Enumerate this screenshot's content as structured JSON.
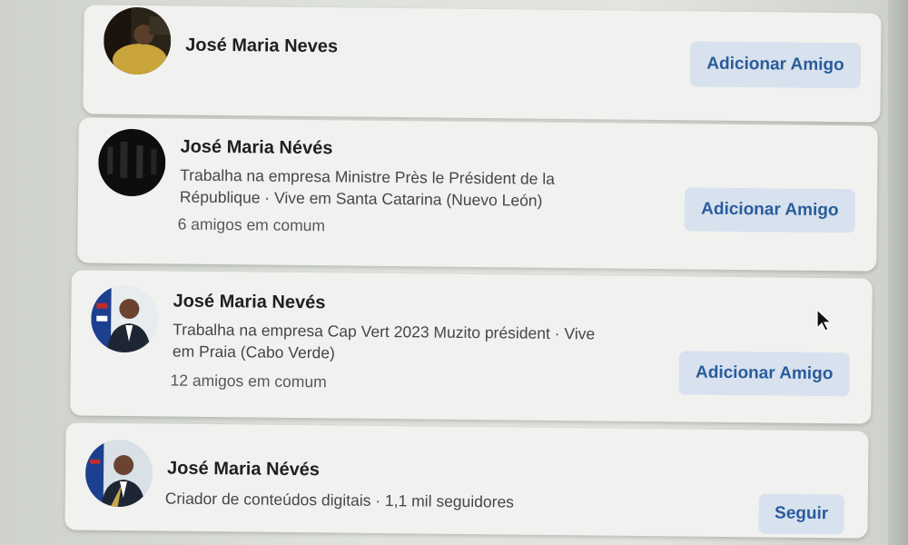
{
  "results": [
    {
      "name": "José Maria Neves",
      "description": "",
      "mutual": "",
      "action": "Adicionar Amigo",
      "avatar": "portrait-photo"
    },
    {
      "name": "José Maria Névés",
      "description_lines": [
        "Trabalha na empresa Ministre Près le Président de la",
        "République · Vive em Santa Catarina (Nuevo León)"
      ],
      "mutual": "6 amigos em comum",
      "action": "Adicionar Amigo",
      "avatar": "dark-photo"
    },
    {
      "name": "José Maria Nevés",
      "description_lines": [
        "Trabalha na empresa Cap Vert 2023 Muzito président · Vive",
        "em Praia (Cabo Verde)"
      ],
      "mutual": "12 amigos em comum",
      "action": "Adicionar Amigo",
      "avatar": "portrait-with-flag"
    },
    {
      "name": "José Maria Névés",
      "description_lines": [
        "Criador de conteúdos digitais · 1,1 mil seguidores"
      ],
      "mutual": "",
      "action": "Seguir",
      "avatar": "portrait-with-flag"
    }
  ],
  "colors": {
    "card_bg": "#f1f2ef",
    "button_bg": "#d7e2ee",
    "button_text": "#2a5c9c",
    "name_text": "#1f1f1f"
  },
  "icons": [
    "mouse-pointer-icon"
  ]
}
